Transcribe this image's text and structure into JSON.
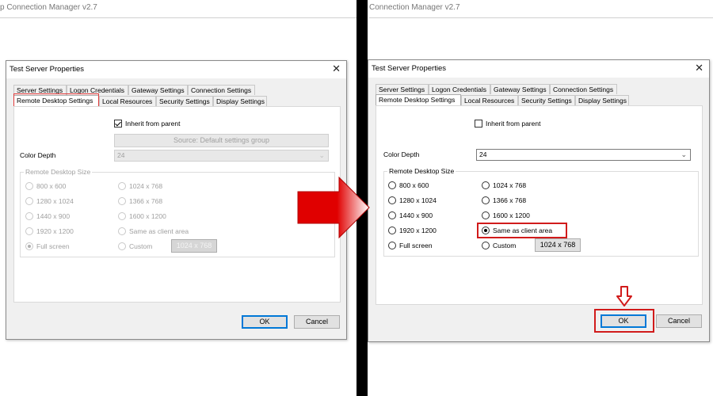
{
  "app_title_left": "p Connection Manager v2.7",
  "app_title_right": "Connection Manager v2.7",
  "left_dialog": {
    "title": "Test Server Properties",
    "tabs_row1": [
      "Server Settings",
      "Logon Credentials",
      "Gateway Settings",
      "Connection Settings"
    ],
    "tabs_row2": [
      "Remote Desktop Settings",
      "Local Resources",
      "Security Settings",
      "Display Settings"
    ],
    "inherit_label": "Inherit from parent",
    "source_button": "Source: Default settings group",
    "color_depth_label": "Color Depth",
    "color_depth_value": "24",
    "group_title": "Remote Desktop Size",
    "sizes_col1": [
      "800 x 600",
      "1280 x 1024",
      "1440 x 900",
      "1920 x 1200",
      "Full screen"
    ],
    "sizes_col2": [
      "1024 x 768",
      "1366 x 768",
      "1600 x 1200",
      "Same as client area",
      "Custom"
    ],
    "custom_value": "1024 x 768",
    "ok": "OK",
    "cancel": "Cancel"
  },
  "right_dialog": {
    "title": "Test Server Properties",
    "tabs_row1": [
      "Server Settings",
      "Logon Credentials",
      "Gateway Settings",
      "Connection Settings"
    ],
    "tabs_row2": [
      "Remote Desktop Settings",
      "Local Resources",
      "Security Settings",
      "Display Settings"
    ],
    "inherit_label": "Inherit from parent",
    "color_depth_label": "Color Depth",
    "color_depth_value": "24",
    "group_title": "Remote Desktop Size",
    "sizes_col1": [
      "800 x 600",
      "1280 x 1024",
      "1440 x 900",
      "1920 x 1200",
      "Full screen"
    ],
    "sizes_col2": [
      "1024 x 768",
      "1366 x 768",
      "1600 x 1200",
      "Same as client area",
      "Custom"
    ],
    "custom_value": "1024 x 768",
    "ok": "OK",
    "cancel": "Cancel"
  },
  "colors": {
    "highlight": "#d11b1b",
    "arrow": "#e00000",
    "divider": "#000000"
  },
  "icons": {
    "transition_arrow": "right-arrow-icon",
    "pointer_arrow": "down-arrow-icon",
    "close": "close-icon"
  }
}
